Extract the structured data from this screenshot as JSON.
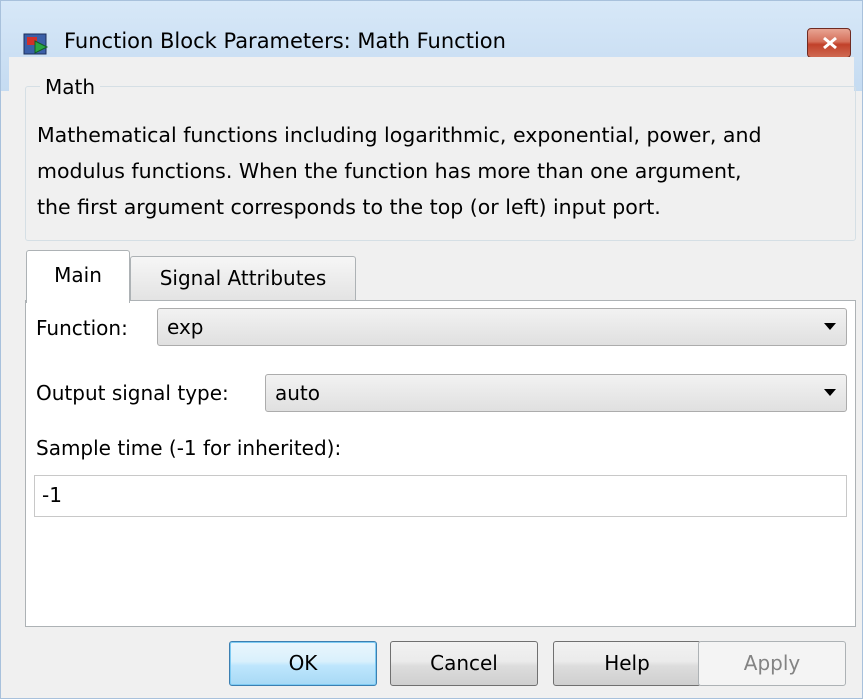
{
  "window": {
    "title": "Function Block Parameters: Math Function",
    "close_icon": "close-icon"
  },
  "group": {
    "legend": "Math",
    "description": "Mathematical functions including logarithmic, exponential, power, and\nmodulus functions.  When the function has more than one argument,\nthe first argument corresponds to the top (or left) input port."
  },
  "tabs": [
    {
      "label": "Main",
      "selected": true
    },
    {
      "label": "Signal Attributes",
      "selected": false
    }
  ],
  "main_tab": {
    "function_label": "Function:",
    "function_value": "exp",
    "output_type_label": "Output signal type:",
    "output_type_value": "auto",
    "sample_time_label": "Sample time (-1 for inherited):",
    "sample_time_value": "-1"
  },
  "buttons": {
    "ok": "OK",
    "cancel": "Cancel",
    "help": "Help",
    "apply": "Apply"
  },
  "colors": {
    "titlebar": "#c5dbf1",
    "close_button": "#c1412a",
    "ok_accent": "#3c7fb1",
    "disabled_text": "#838383"
  }
}
